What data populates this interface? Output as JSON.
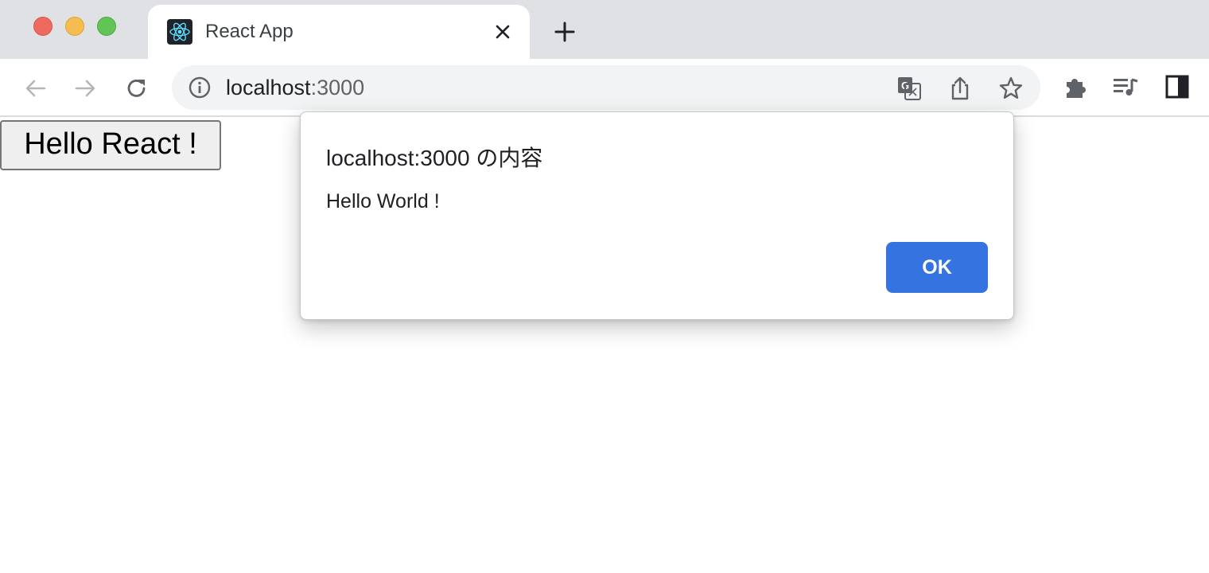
{
  "window": {
    "traffic_lights": [
      "close",
      "minimize",
      "zoom"
    ]
  },
  "tab": {
    "title": "React App",
    "favicon": "react-logo-icon"
  },
  "toolbar": {
    "url_host": "localhost",
    "url_port": ":3000",
    "icons": [
      "back-icon",
      "forward-icon",
      "reload-icon",
      "site-info-icon",
      "translate-icon",
      "share-icon",
      "bookmark-star-icon",
      "extensions-icon",
      "media-control-icon",
      "side-panel-icon"
    ]
  },
  "page": {
    "button_label": "Hello React !"
  },
  "dialog": {
    "title": "localhost:3000 の内容",
    "message": "Hello World !",
    "ok_label": "OK"
  },
  "colors": {
    "accent": "#3574e0",
    "tabstrip": "#dfe1e5",
    "omnibox": "#f1f3f4"
  }
}
